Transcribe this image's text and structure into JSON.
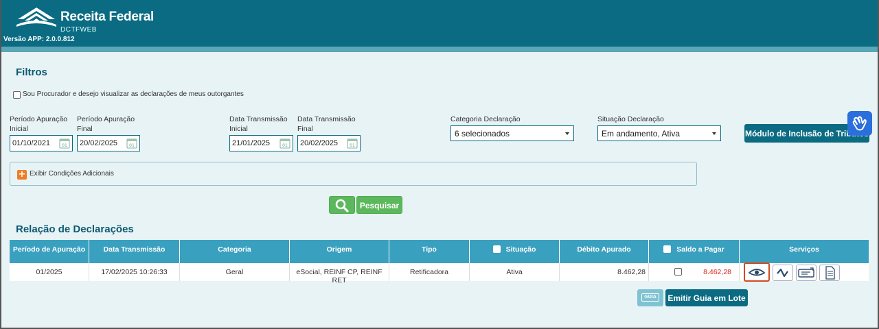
{
  "header": {
    "brand": "Receita Federal",
    "sub": "DCTFWEB",
    "version": "Versão APP: 2.0.0.812"
  },
  "filters": {
    "title": "Filtros",
    "procurador_label": "Sou Procurador e desejo visualizar as declarações de meus outorgantes",
    "periodo_inicial_label": "Período Apuração",
    "periodo_inicial_sub": "Inicial",
    "periodo_inicial_value": "01/10/2021",
    "periodo_final_label": "Período Apuração",
    "periodo_final_sub": "Final",
    "periodo_final_value": "20/02/2025",
    "transmissao_inicial_label": "Data Transmissão",
    "transmissao_inicial_sub": "Inicial",
    "transmissao_inicial_value": "21/01/2025",
    "transmissao_final_label": "Data Transmissão",
    "transmissao_final_sub": "Final",
    "transmissao_final_value": "20/02/2025",
    "categoria_label": "Categoria Declaração",
    "categoria_value": "6 selecionados",
    "situacao_label": "Situação Declaração",
    "situacao_value": "Em andamento, Ativa",
    "modulo_button": "Módulo de Inclusão de Tributos",
    "condicoes_label": "Exibir Condições Adicionais",
    "search_button": "Pesquisar"
  },
  "declaracoes": {
    "title": "Relação de Declarações",
    "columns": {
      "periodo": "Período de Apuração",
      "transmissao": "Data Transmissão",
      "categoria": "Categoria",
      "origem": "Origem",
      "tipo": "Tipo",
      "situacao": "Situação",
      "debito": "Débito Apurado",
      "saldo": "Saldo a Pagar",
      "servicos": "Serviços"
    },
    "rows": [
      {
        "periodo": "01/2025",
        "transmissao": "17/02/2025 10:26:33",
        "categoria": "Geral",
        "origem": "eSocial, REINF CP, REINF RET",
        "tipo": "Retificadora",
        "situacao": "Ativa",
        "debito": "8.462,28",
        "saldo": "8.462,28"
      }
    ],
    "guia_label": "GUIA",
    "emitir_button": "Emitir Guia em Lote"
  },
  "colors": {
    "header": "#0b6b82",
    "table_header": "#3aa0c0",
    "accent_red": "#e0201a",
    "green": "#5cb85c",
    "highlight": "#d24a1e"
  }
}
